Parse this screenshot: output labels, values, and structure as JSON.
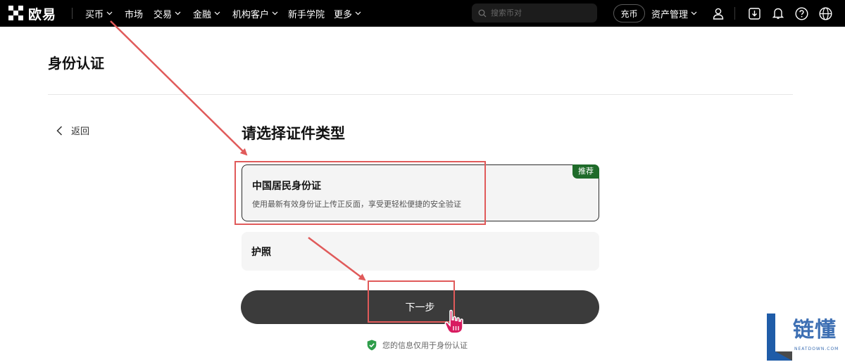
{
  "brand": {
    "name": "欧易"
  },
  "nav": {
    "items": [
      {
        "label": "买币",
        "has_dropdown": true
      },
      {
        "label": "市场",
        "has_dropdown": false
      },
      {
        "label": "交易",
        "has_dropdown": true
      },
      {
        "label": "金融",
        "has_dropdown": true
      },
      {
        "label": "机构客户",
        "has_dropdown": true
      },
      {
        "label": "新手学院",
        "has_dropdown": false
      },
      {
        "label": "更多",
        "has_dropdown": true
      }
    ],
    "search_placeholder": "搜索币对",
    "deposit_label": "充币",
    "assets_label": "资产管理",
    "icons": [
      "user-icon",
      "download-icon",
      "bell-icon",
      "help-icon",
      "globe-icon"
    ]
  },
  "page": {
    "title": "身份认证",
    "back_label": "返回",
    "heading": "请选择证件类型",
    "options": [
      {
        "title": "中国居民身份证",
        "desc": "使用最新有效身份证上传正反面，享受更轻松便捷的安全验证",
        "badge": "推荐",
        "selected": true
      },
      {
        "title": "护照",
        "selected": false
      }
    ],
    "next_label": "下一步",
    "privacy_note": "您的信息仅用于身份认证"
  },
  "colors": {
    "topbar": "#000000",
    "badge": "#1f6b2a",
    "button": "#3b3b3b",
    "annotation": "#e05a5a",
    "shield": "#2e9d4a"
  },
  "watermark": {
    "text": "链懂",
    "sub": "NEATDOWN.COM"
  }
}
